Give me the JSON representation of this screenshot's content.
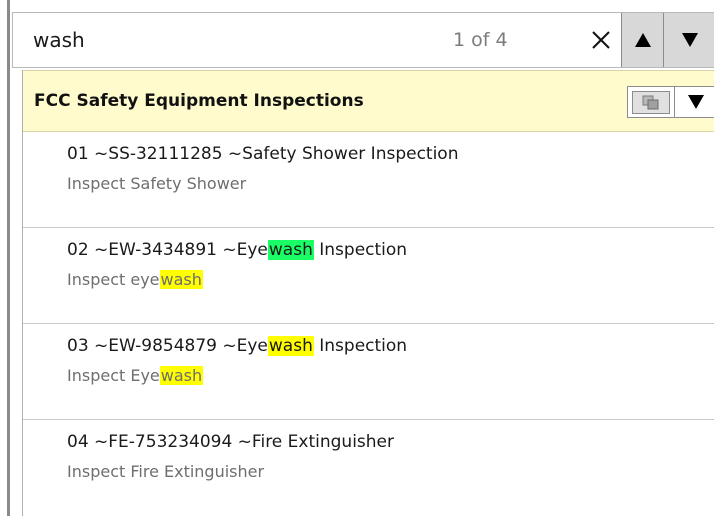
{
  "search": {
    "query": "wash",
    "match_counter": "1 of 4",
    "clear_glyph": "×",
    "prev_glyph": "▲",
    "next_glyph": "▼"
  },
  "group": {
    "title": "FCC Safety Equipment Inspections",
    "dropdown_glyph": "▼",
    "copy_icon": "copy-icon"
  },
  "highlight_colors": {
    "current_match": "#1aff66",
    "other_match": "#ffff00"
  },
  "items": [
    {
      "title": "01 ~SS-32111285 ~Safety Shower Inspection",
      "description": "Inspect Safety Shower"
    },
    {
      "title_before": "02 ~EW-3434891 ~Eye",
      "title_match": "wash",
      "title_after": " Inspection",
      "desc_before": "Inspect eye",
      "desc_match": "wash"
    },
    {
      "title_before": "03 ~EW-9854879 ~Eye",
      "title_match": "wash",
      "title_after": " Inspection",
      "desc_before": "Inspect Eye",
      "desc_match": "wash"
    },
    {
      "title": "04 ~FE-753234094 ~Fire Extinguisher",
      "description": "Inspect Fire Extinguisher"
    }
  ]
}
